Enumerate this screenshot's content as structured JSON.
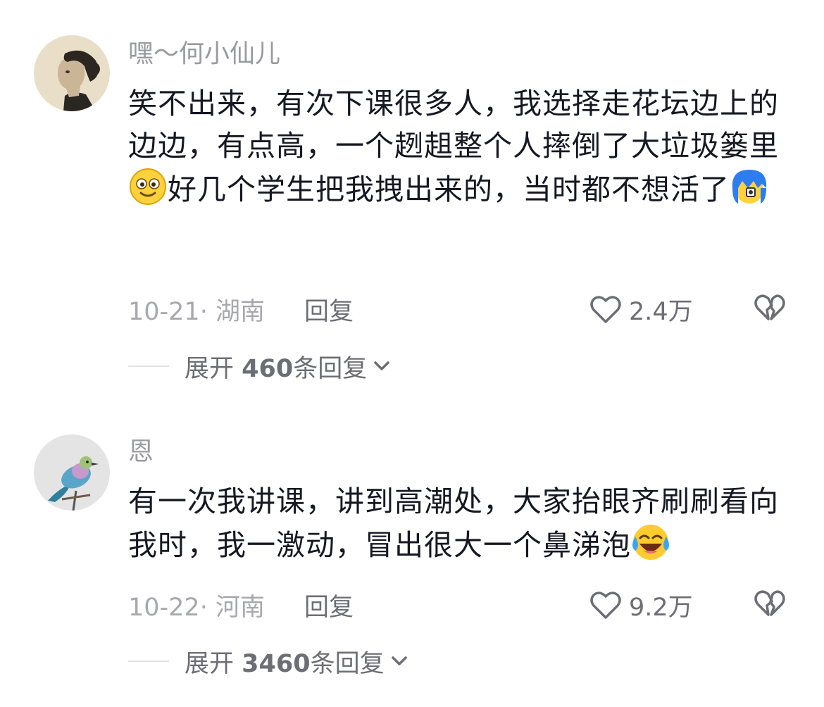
{
  "comments": [
    {
      "username": "嘿～何小仙儿",
      "text_parts": [
        "笑不出来，有次下课很多人，我选择走花坛边上的边边，有点高，一个趔趄整个人摔倒了大垃圾篓里",
        "好几个学生把我拽出来的，当时都不想活了"
      ],
      "emoji_1": "smiling-face-emoji",
      "emoji_2": "blue-hair-face-emoji",
      "date": "10-21· 湖南",
      "reply_label": "回复",
      "likes": "2.4万",
      "expand_prefix": "展开",
      "expand_count": "460",
      "expand_suffix": "条回复"
    },
    {
      "username": "恩",
      "text_parts": [
        "有一次我讲课，讲到高潮处，大家抬眼齐刷刷看向我时，我一激动，冒出很大一个鼻涕泡"
      ],
      "emoji_1": "crying-laughing-face-emoji",
      "date": "10-22· 河南",
      "reply_label": "回复",
      "likes": "9.2万",
      "expand_prefix": "展开",
      "expand_count": "3460",
      "expand_suffix": "条回复"
    }
  ],
  "colors": {
    "text": "#161823",
    "muted": "#9a9ba1",
    "action": "#6d6e75",
    "divider": "#e3e3e6"
  },
  "icons": [
    "heart-outline-icon",
    "broken-heart-icon",
    "chevron-down-icon"
  ]
}
